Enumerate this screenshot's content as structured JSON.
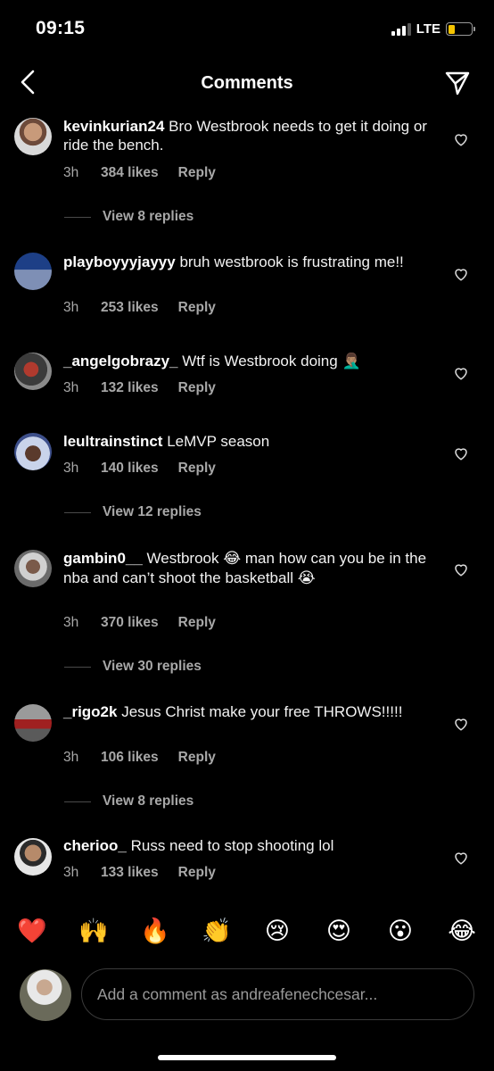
{
  "status": {
    "time": "09:15",
    "network": "LTE",
    "battery_level": 0.3
  },
  "header": {
    "title": "Comments",
    "back_icon": "chevron-left-icon",
    "send_icon": "paper-plane-icon"
  },
  "comments": [
    {
      "username": "kevinkurian24",
      "text": "Bro Westbrook needs to get it doing or ride the bench.",
      "emoji": "",
      "time": "3h",
      "likes": "384 likes",
      "reply": "Reply",
      "view_replies": "View 8 replies"
    },
    {
      "username": "playboyyyjayyy",
      "text": "bruh westbrook is frustrating me!!",
      "emoji": "",
      "time": "3h",
      "likes": "253 likes",
      "reply": "Reply",
      "view_replies": ""
    },
    {
      "username": "_angelgobrazy_",
      "text": "Wtf is Westbrook doing",
      "emoji": "🤦🏽‍♂️",
      "time": "3h",
      "likes": "132 likes",
      "reply": "Reply",
      "view_replies": ""
    },
    {
      "username": "leultrainstinct",
      "text": "LeMVP season",
      "emoji": "",
      "time": "3h",
      "likes": "140 likes",
      "reply": "Reply",
      "view_replies": "View 12 replies"
    },
    {
      "username": "gambin0__",
      "text_before": "Westbrook",
      "emoji_mid": "😂",
      "text_after": "man how can you be in the nba and can’t shoot the basketball",
      "emoji_end": "😭",
      "time": "3h",
      "likes": "370 likes",
      "reply": "Reply",
      "view_replies": "View 30 replies"
    },
    {
      "username": "_rigo2k",
      "text": "Jesus Christ make your free THROWS!!!!!",
      "emoji": "",
      "time": "3h",
      "likes": "106 likes",
      "reply": "Reply",
      "view_replies": "View 8 replies"
    },
    {
      "username": "cherioo_",
      "text": "Russ need to stop shooting lol",
      "emoji": "",
      "time": "3h",
      "likes": "133 likes",
      "reply": "Reply",
      "view_replies": ""
    }
  ],
  "reactions": [
    "❤️",
    "🙌",
    "🔥",
    "👏",
    "😢",
    "😍",
    "😮",
    "😂"
  ],
  "composer": {
    "placeholder": "Add a comment as andreafenechcesar..."
  },
  "colors": {
    "background": "#000000",
    "secondary_text": "#a8a8a8",
    "battery": "#f5c400"
  }
}
